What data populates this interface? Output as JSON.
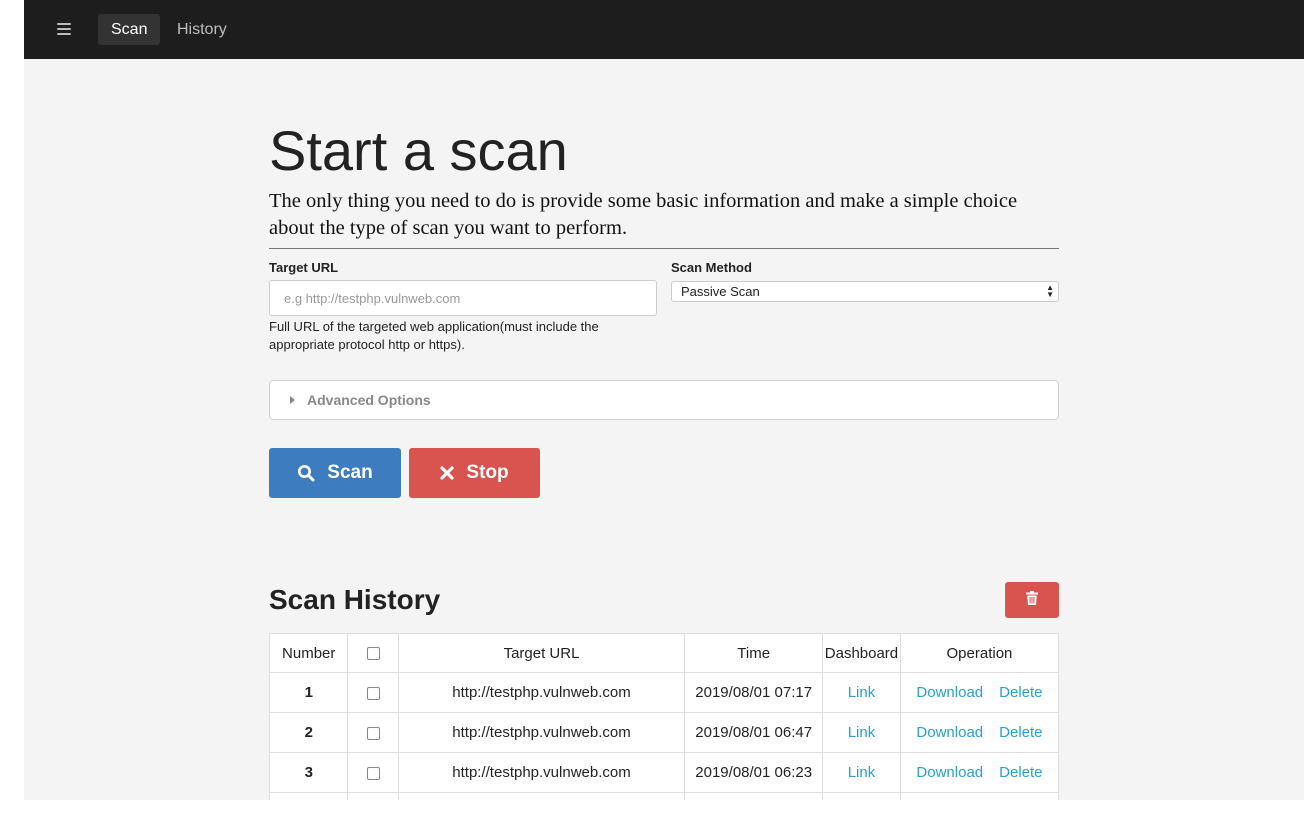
{
  "nav": {
    "menu_icon": "hamburger-menu-icon",
    "tabs": [
      {
        "label": "Scan",
        "active": true
      },
      {
        "label": "History",
        "active": false
      }
    ]
  },
  "page": {
    "title": "Start a scan",
    "subtitle": "The only thing you need to do is provide some basic information and make a simple choice about the type of scan you want to perform."
  },
  "form": {
    "target_url_label": "Target URL",
    "target_url_placeholder": "e.g http://testphp.vulnweb.com",
    "target_url_value": "",
    "target_url_help": "Full URL of the targeted web application(must include the appropriate protocol http or https).",
    "scan_method_label": "Scan Method",
    "scan_method_value": "Passive Scan",
    "advanced_label": "Advanced Options"
  },
  "buttons": {
    "scan_label": "Scan",
    "scan_icon": "search-icon",
    "stop_label": "Stop",
    "stop_icon": "x-icon",
    "scan_color": "#3e7cc0",
    "stop_color": "#d9534f"
  },
  "history": {
    "title": "Scan History",
    "delete_all_icon": "trash-icon",
    "columns": [
      "Number",
      "",
      "Target URL",
      "Time",
      "Dashboard",
      "Operation"
    ],
    "rows": [
      {
        "number": "1",
        "url": "http://testphp.vulnweb.com",
        "time": "2019/08/01 07:17",
        "dashboard": "Link",
        "download": "Download",
        "delete": "Delete"
      },
      {
        "number": "2",
        "url": "http://testphp.vulnweb.com",
        "time": "2019/08/01 06:47",
        "dashboard": "Link",
        "download": "Download",
        "delete": "Delete"
      },
      {
        "number": "3",
        "url": "http://testphp.vulnweb.com",
        "time": "2019/08/01 06:23",
        "dashboard": "Link",
        "download": "Download",
        "delete": "Delete"
      }
    ],
    "link_color": "#2a9fd6"
  }
}
